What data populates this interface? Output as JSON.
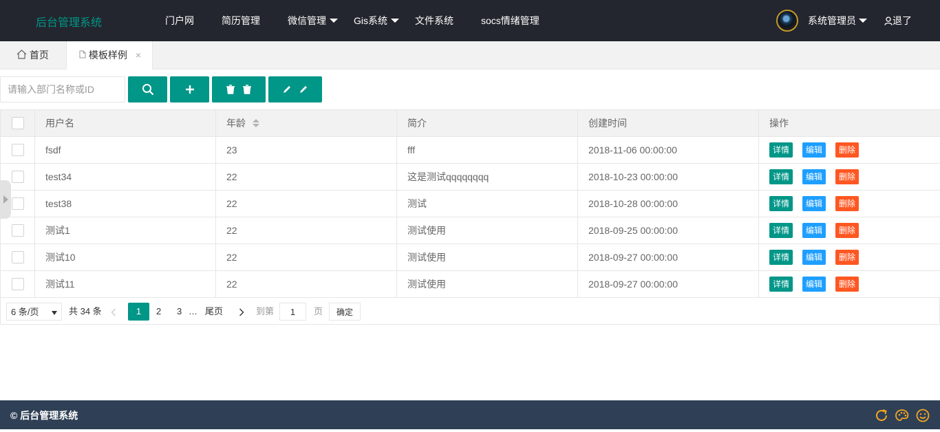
{
  "header": {
    "logo": "后台管理系统",
    "nav": [
      {
        "label": "门户网",
        "dropdown": false
      },
      {
        "label": "简历管理",
        "dropdown": false
      },
      {
        "label": "微信管理",
        "dropdown": true
      },
      {
        "label": "Gis系统",
        "dropdown": true
      },
      {
        "label": "文件系统",
        "dropdown": false
      },
      {
        "label": "socs情绪管理",
        "dropdown": false
      }
    ],
    "user": "系统管理员",
    "logout": "退了"
  },
  "tabs": {
    "home": "首页",
    "active": "模板样例",
    "close": "×"
  },
  "toolbar": {
    "search_placeholder": "请输入部门名称或ID"
  },
  "table": {
    "columns": [
      "用户名",
      "年龄",
      "简介",
      "创建时间",
      "操作"
    ],
    "rows": [
      {
        "username": "fsdf",
        "age": "23",
        "intro": "fff",
        "created": "2018-11-06 00:00:00"
      },
      {
        "username": "test34",
        "age": "22",
        "intro": "这是测试qqqqqqqq",
        "created": "2018-10-23 00:00:00"
      },
      {
        "username": "test38",
        "age": "22",
        "intro": "测试",
        "created": "2018-10-28 00:00:00"
      },
      {
        "username": "测试1",
        "age": "22",
        "intro": "测试使用",
        "created": "2018-09-25 00:00:00"
      },
      {
        "username": "测试10",
        "age": "22",
        "intro": "测试使用",
        "created": "2018-09-27 00:00:00"
      },
      {
        "username": "测试11",
        "age": "22",
        "intro": "测试使用",
        "created": "2018-09-27 00:00:00"
      }
    ],
    "actions": {
      "detail": "详情",
      "edit": "编辑",
      "delete": "删除"
    }
  },
  "pagination": {
    "page_size": "6 条/页",
    "total": "共 34 条",
    "pages": [
      "1",
      "2",
      "3"
    ],
    "current": "1",
    "ellipsis": "…",
    "last": "尾页",
    "goto_prefix": "到第",
    "goto_value": "1",
    "goto_suffix": "页",
    "confirm": "确定"
  },
  "footer": {
    "text": "© 后台管理系统"
  },
  "colors": {
    "header_bg": "#23262e",
    "primary": "#009688",
    "edit": "#1e9fff",
    "danger": "#ff5722",
    "footer_bg": "#2f4056",
    "footer_icon": "#f5a623"
  }
}
